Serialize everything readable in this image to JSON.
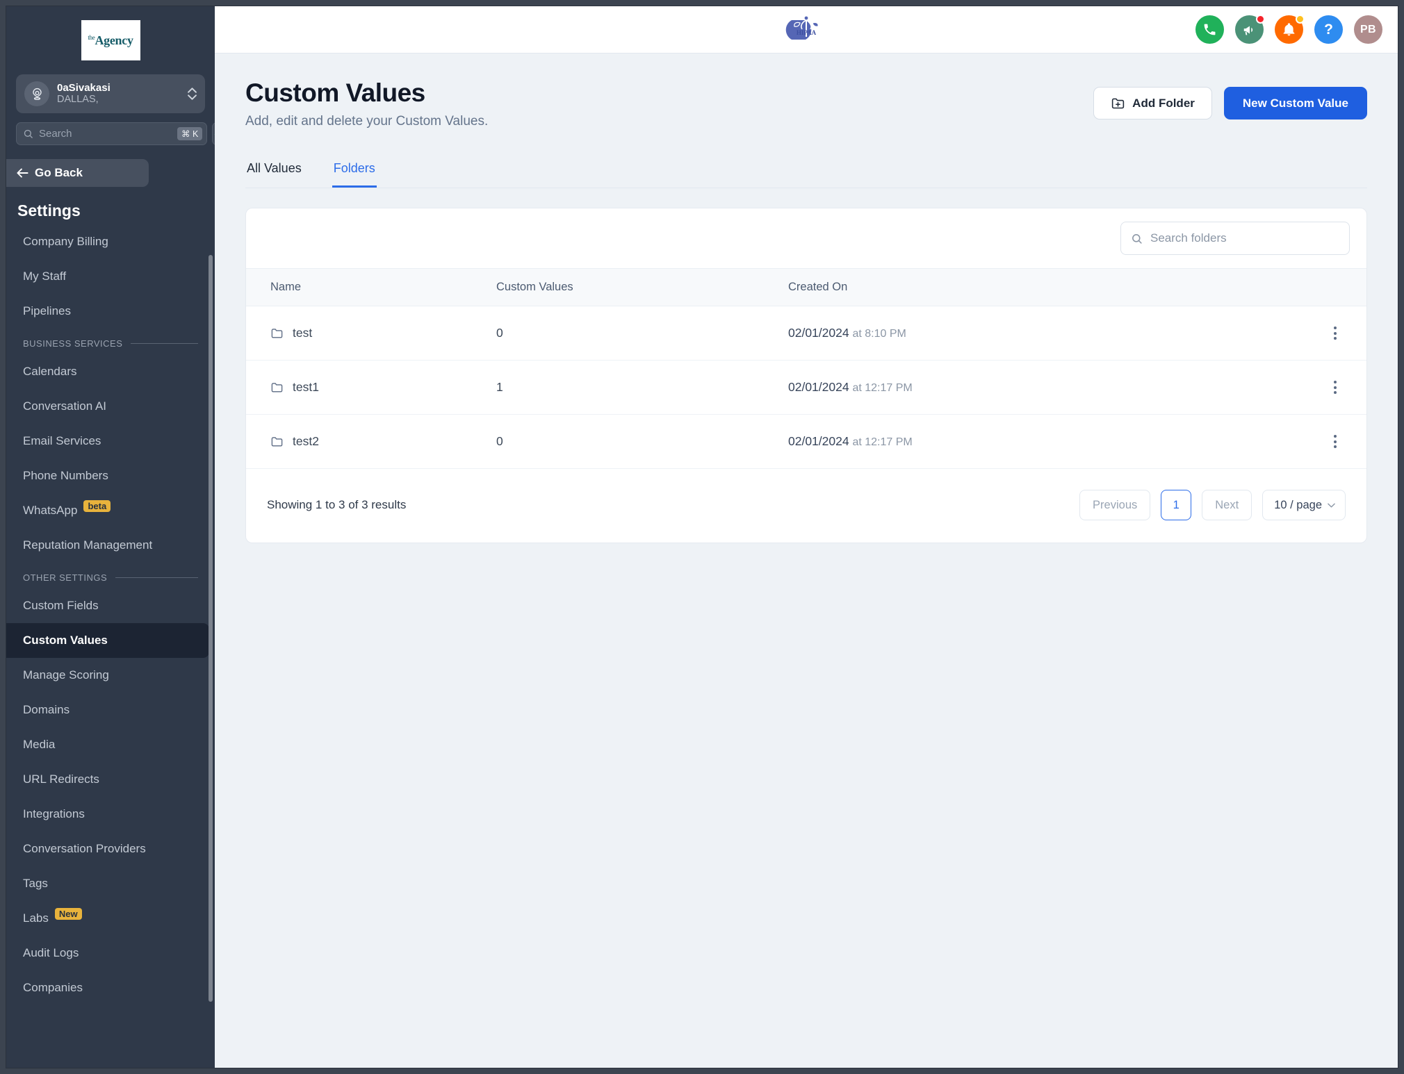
{
  "sidebar": {
    "logo": {
      "prefix": "the",
      "name": "Agency"
    },
    "account": {
      "name": "0aSivakasi",
      "sub": "DALLAS,",
      "icon": "location-pin-icon"
    },
    "search": {
      "placeholder": "Search",
      "shortcut": "⌘ K",
      "icon": "search-icon",
      "bolt_icon": "lightning-bolt-icon"
    },
    "go_back": "Go Back",
    "settings_title": "Settings",
    "items": [
      {
        "label": "Company Billing",
        "active": false
      },
      {
        "label": "My Staff",
        "active": false
      },
      {
        "label": "Pipelines",
        "active": false
      },
      {
        "section": "BUSINESS SERVICES"
      },
      {
        "label": "Calendars",
        "active": false
      },
      {
        "label": "Conversation AI",
        "active": false
      },
      {
        "label": "Email Services",
        "active": false
      },
      {
        "label": "Phone Numbers",
        "active": false
      },
      {
        "label": "WhatsApp",
        "badge": "beta",
        "active": false
      },
      {
        "label": "Reputation Management",
        "active": false
      },
      {
        "section": "OTHER SETTINGS"
      },
      {
        "label": "Custom Fields",
        "active": false
      },
      {
        "label": "Custom Values",
        "active": true
      },
      {
        "label": "Manage Scoring",
        "active": false
      },
      {
        "label": "Domains",
        "active": false
      },
      {
        "label": "Media",
        "active": false
      },
      {
        "label": "URL Redirects",
        "active": false
      },
      {
        "label": "Integrations",
        "active": false
      },
      {
        "label": "Conversation Providers",
        "active": false
      },
      {
        "label": "Tags",
        "active": false
      },
      {
        "label": "Labs",
        "badge": "New",
        "active": false
      },
      {
        "label": "Audit Logs",
        "active": false
      },
      {
        "label": "Companies",
        "active": false
      }
    ]
  },
  "topbar": {
    "center_logo": "hipaa-badge-icon",
    "center_logo_text": "HIPAA",
    "icons": [
      {
        "name": "phone-icon",
        "color": "#20b15a",
        "badge": null
      },
      {
        "name": "megaphone-icon",
        "color": "#4b9277",
        "badge": "red"
      },
      {
        "name": "bell-icon",
        "color": "#ff6a00",
        "badge": "yellow"
      },
      {
        "name": "help-icon",
        "color": "#2e8cf0",
        "glyph": "?"
      }
    ],
    "avatar": {
      "initials": "PB",
      "color": "#b08d8d"
    }
  },
  "page": {
    "title": "Custom Values",
    "subtitle": "Add, edit and delete your Custom Values.",
    "add_folder_label": "Add Folder",
    "add_folder_icon": "folder-plus-icon",
    "new_custom_value_label": "New Custom Value"
  },
  "tabs": [
    {
      "label": "All Values",
      "active": false
    },
    {
      "label": "Folders",
      "active": true
    }
  ],
  "folder_search": {
    "placeholder": "Search folders",
    "icon": "search-icon",
    "value": ""
  },
  "table": {
    "columns": [
      "Name",
      "Custom Values",
      "Created On"
    ],
    "rows": [
      {
        "name": "test",
        "icon": "folder-icon",
        "custom_values": "0",
        "date": "02/01/2024",
        "time": "at 8:10 PM"
      },
      {
        "name": "test1",
        "icon": "folder-icon",
        "custom_values": "1",
        "date": "02/01/2024",
        "time": "at 12:17 PM"
      },
      {
        "name": "test2",
        "icon": "folder-icon",
        "custom_values": "0",
        "date": "02/01/2024",
        "time": "at 12:17 PM"
      }
    ]
  },
  "footer": {
    "showing": "Showing 1 to 3 of 3 results",
    "previous": "Previous",
    "current_page": "1",
    "next": "Next",
    "page_size": "10 / page"
  },
  "colors": {
    "accent": "#2c6ce8",
    "primary_button": "#1f5fe0",
    "sidebar_bg": "#2f3949",
    "sidebar_active": "#1c2433",
    "badge_yellow": "#e8b33c"
  }
}
